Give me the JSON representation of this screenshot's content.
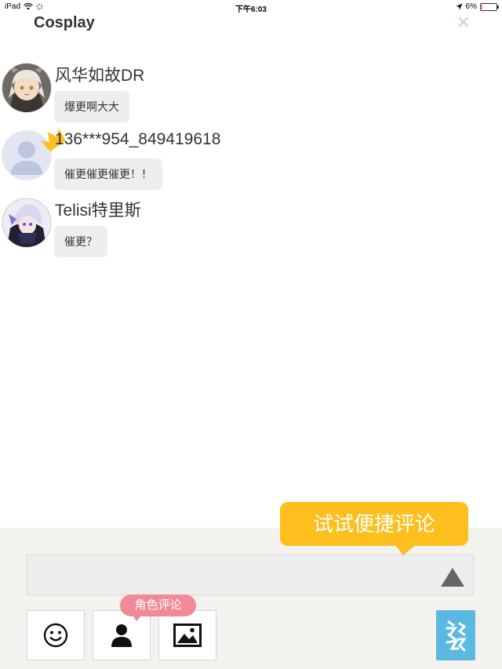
{
  "status_bar": {
    "device": "iPad",
    "time": "下午6:03",
    "battery": "6%",
    "battery_level": 0.06
  },
  "header": {
    "title": "Cosplay",
    "close_icon": "close-icon"
  },
  "comments": [
    {
      "username": "风华如故DR",
      "text": "爆更啊大大"
    },
    {
      "username": "136***954_849419618",
      "text": "催更催更催更！！"
    },
    {
      "username": "Telisi特里斯",
      "text": "催更？"
    }
  ],
  "composer": {
    "tip": "试试便捷评论",
    "input_value": "",
    "input_placeholder": "",
    "role_badge": "角色评论",
    "emoji_icon": "smiley-icon",
    "role_icon": "person-icon",
    "image_icon": "image-icon",
    "send_icon": "triangle-up-icon"
  },
  "colors": {
    "tip_bg": "#fcbf1e",
    "role_badge_bg": "#f18a96",
    "side_button_bg": "#5bb8e0",
    "bottom_bg": "#f4f2ee"
  }
}
